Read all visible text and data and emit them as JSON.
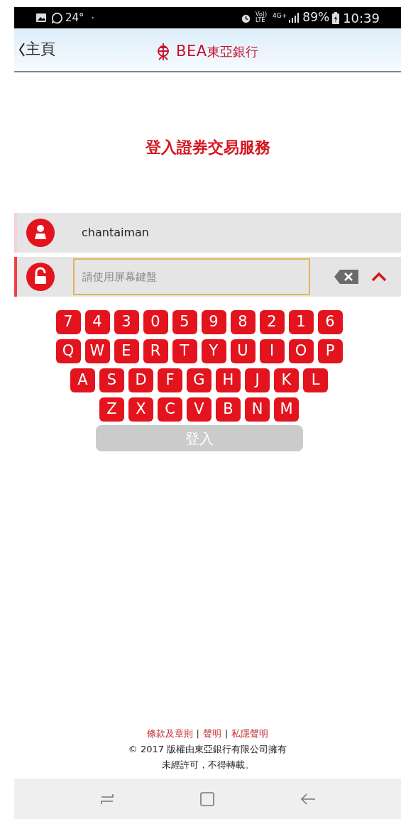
{
  "status_bar": {
    "temperature": "24°",
    "dot": "·",
    "volte": [
      "Vo))",
      "LTE"
    ],
    "network": "4G+",
    "battery": "89%",
    "time": "10:39"
  },
  "header": {
    "back_label": "主頁",
    "logo_latin": "BEA",
    "logo_chinese": "東亞銀行"
  },
  "title": "登入證券交易服務",
  "fields": [
    {
      "kind": "username",
      "value": "chantaiman",
      "active": false
    },
    {
      "kind": "password",
      "placeholder": "請使用屏幕鍵盤",
      "active": true
    }
  ],
  "keyboard": {
    "rows": [
      [
        "7",
        "4",
        "3",
        "0",
        "5",
        "9",
        "8",
        "2",
        "1",
        "6"
      ],
      [
        "Q",
        "W",
        "E",
        "R",
        "T",
        "Y",
        "U",
        "I",
        "O",
        "P"
      ],
      [
        "A",
        "S",
        "D",
        "F",
        "G",
        "H",
        "J",
        "K",
        "L"
      ],
      [
        "Z",
        "X",
        "C",
        "V",
        "B",
        "N",
        "M"
      ]
    ]
  },
  "login_button": {
    "label": "登入",
    "disabled": true
  },
  "footer": {
    "links": [
      "條款及章則",
      "聲明",
      "私隱聲明"
    ],
    "separator": "|",
    "copyright": "© 2017 版權由東亞銀行有限公司擁有",
    "notice": "未經許可，不得轉載。"
  }
}
